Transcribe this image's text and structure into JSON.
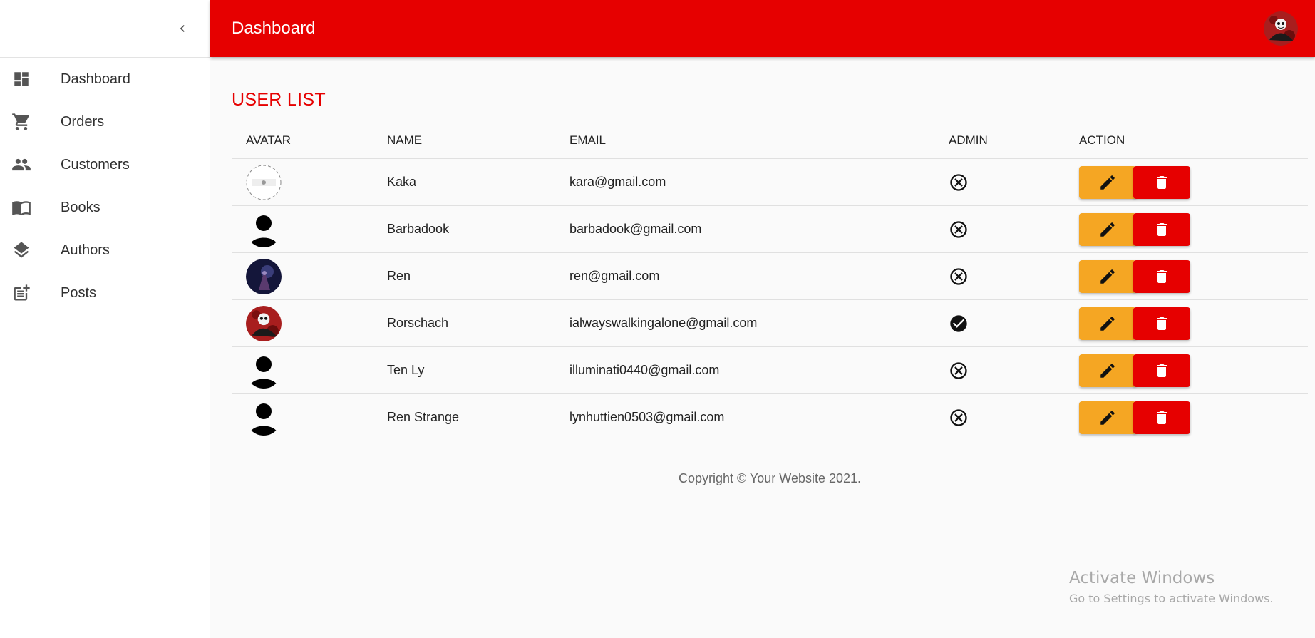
{
  "sidebar": {
    "items": [
      {
        "label": "Dashboard",
        "icon": "dashboard-icon"
      },
      {
        "label": "Orders",
        "icon": "cart-icon"
      },
      {
        "label": "Customers",
        "icon": "people-icon"
      },
      {
        "label": "Books",
        "icon": "book-icon"
      },
      {
        "label": "Authors",
        "icon": "layers-icon"
      },
      {
        "label": "Posts",
        "icon": "post-add-icon"
      }
    ]
  },
  "header": {
    "title": "Dashboard",
    "color": "#e60000"
  },
  "main": {
    "section_title": "USER LIST",
    "columns": [
      "AVATAR",
      "NAME",
      "EMAIL",
      "ADMIN",
      "ACTION"
    ],
    "rows": [
      {
        "avatar": "logo-avatar",
        "name": "Kaka",
        "email": "kara@gmail.com",
        "admin": false
      },
      {
        "avatar": "default-person-avatar",
        "name": "Barbadook",
        "email": "barbadook@gmail.com",
        "admin": false
      },
      {
        "avatar": "dark-artwork-avatar",
        "name": "Ren",
        "email": "ren@gmail.com",
        "admin": false
      },
      {
        "avatar": "skull-red-avatar",
        "name": "Rorschach",
        "email": "ialwayswalkingalone@gmail.com",
        "admin": true
      },
      {
        "avatar": "default-person-avatar",
        "name": "Ten Ly",
        "email": "illuminati0440@gmail.com",
        "admin": false
      },
      {
        "avatar": "default-person-avatar",
        "name": "Ren Strange",
        "email": "lynhuttien0503@gmail.com",
        "admin": false
      }
    ],
    "edit_color": "#f5a623",
    "delete_color": "#e60000"
  },
  "footer": {
    "text": "Copyright © Your Website 2021."
  },
  "watermark": {
    "title": "Activate Windows",
    "subtitle": "Go to Settings to activate Windows."
  }
}
